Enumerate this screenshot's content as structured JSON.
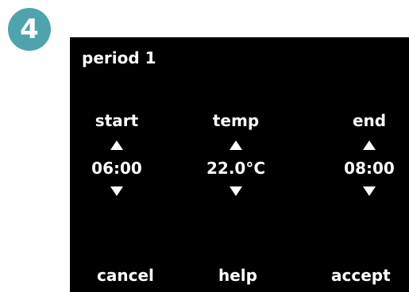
{
  "step_number": "4",
  "screen": {
    "title": "period 1",
    "columns": {
      "start": {
        "label": "start",
        "value": "06:00"
      },
      "temp": {
        "label": "temp",
        "value": "22.0°C"
      },
      "end": {
        "label": "end",
        "value": "08:00"
      }
    },
    "buttons": {
      "cancel": "cancel",
      "help": "help",
      "accept": "accept"
    }
  },
  "icons": {
    "up": "up-arrow-icon",
    "down": "down-arrow-icon"
  },
  "colors": {
    "badge": "#4fa3ad",
    "screen_bg": "#000000",
    "screen_text": "#ffffff"
  }
}
